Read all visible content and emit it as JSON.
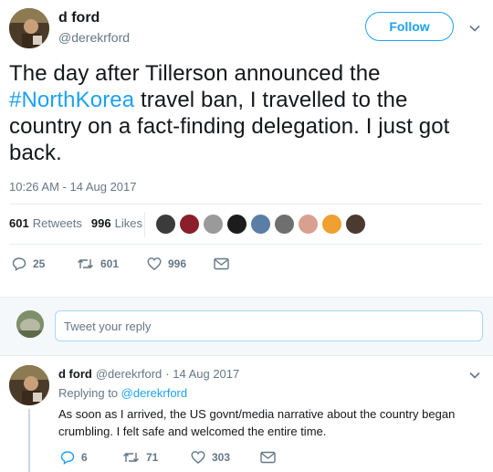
{
  "tweet": {
    "author_name": "d ford",
    "author_handle": "@derekrford",
    "follow_label": "Follow",
    "text_before": "The day after Tillerson announced the ",
    "hashtag": "#NorthKorea",
    "text_after": " travel ban, I travelled to the country on a fact-finding delegation. I just got back.",
    "timestamp": "10:26 AM - 14 Aug 2017",
    "retweets_count": "601",
    "retweets_label": "Retweets",
    "likes_count": "996",
    "likes_label": "Likes",
    "actions": {
      "reply_count": "25",
      "retweet_count": "601",
      "like_count": "996"
    }
  },
  "reply_box": {
    "placeholder": "Tweet your reply"
  },
  "reply": {
    "author_name": "d ford",
    "author_handle": "@derekrford",
    "date": "· 14 Aug 2017",
    "replying_prefix": "Replying to",
    "replying_handle": "@derekrford",
    "text": "As soon as I arrived, the US govnt/media narrative about the country began crumbling. I felt safe and welcomed the entire time.",
    "actions": {
      "reply_count": "6",
      "retweet_count": "71",
      "like_count": "303"
    }
  },
  "colors": {
    "accent": "#1da1f2",
    "text": "#14171a",
    "muted": "#657786",
    "divider": "#e6ecf0"
  }
}
